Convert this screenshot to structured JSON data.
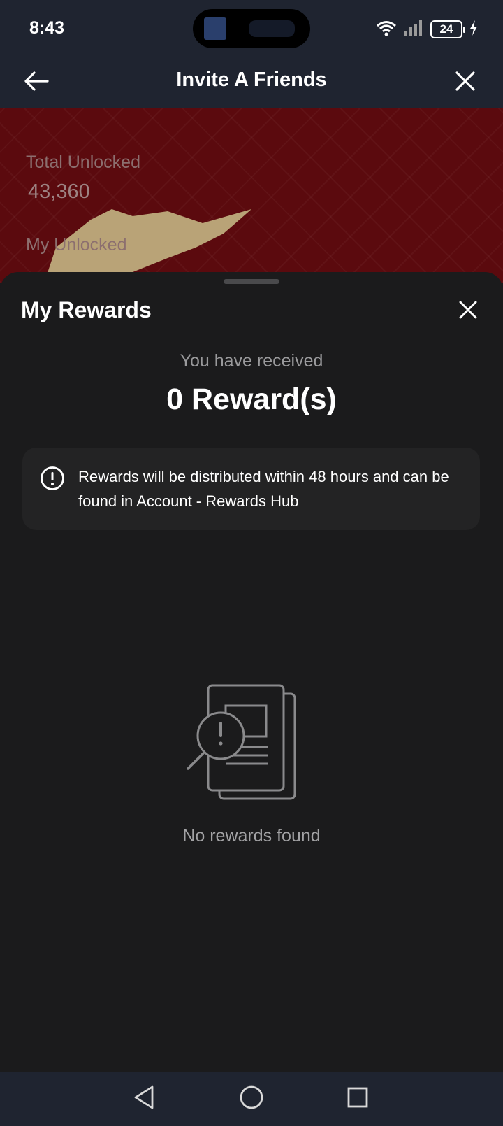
{
  "status_bar": {
    "time": "8:43",
    "battery": "24",
    "icons": [
      "wifi-icon",
      "signal-icon",
      "battery-icon",
      "charging-icon"
    ]
  },
  "header": {
    "title": "Invite A Friends",
    "back_icon": "back-arrow-icon",
    "close_icon": "close-icon"
  },
  "background": {
    "total_unlocked_label": "Total Unlocked",
    "total_unlocked_value": "43,360",
    "my_unlocked_label": "My Unlocked"
  },
  "rewards_sheet": {
    "title": "My Rewards",
    "received_label": "You have received",
    "reward_count": "0 Reward(s)",
    "info_message": "Rewards will be distributed within 48 hours and can be found in Account - Rewards Hub",
    "empty_message": "No rewards found",
    "info_icon": "info-icon",
    "empty_icon": "no-results-document-icon"
  },
  "nav_bar": {
    "icons": [
      "back-triangle-icon",
      "home-circle-icon",
      "recents-square-icon"
    ]
  },
  "colors": {
    "app_bar": "#1f2430",
    "sheet_bg": "#1b1b1c",
    "info_box_bg": "#232324",
    "banner_red": "#5b0a0e"
  }
}
